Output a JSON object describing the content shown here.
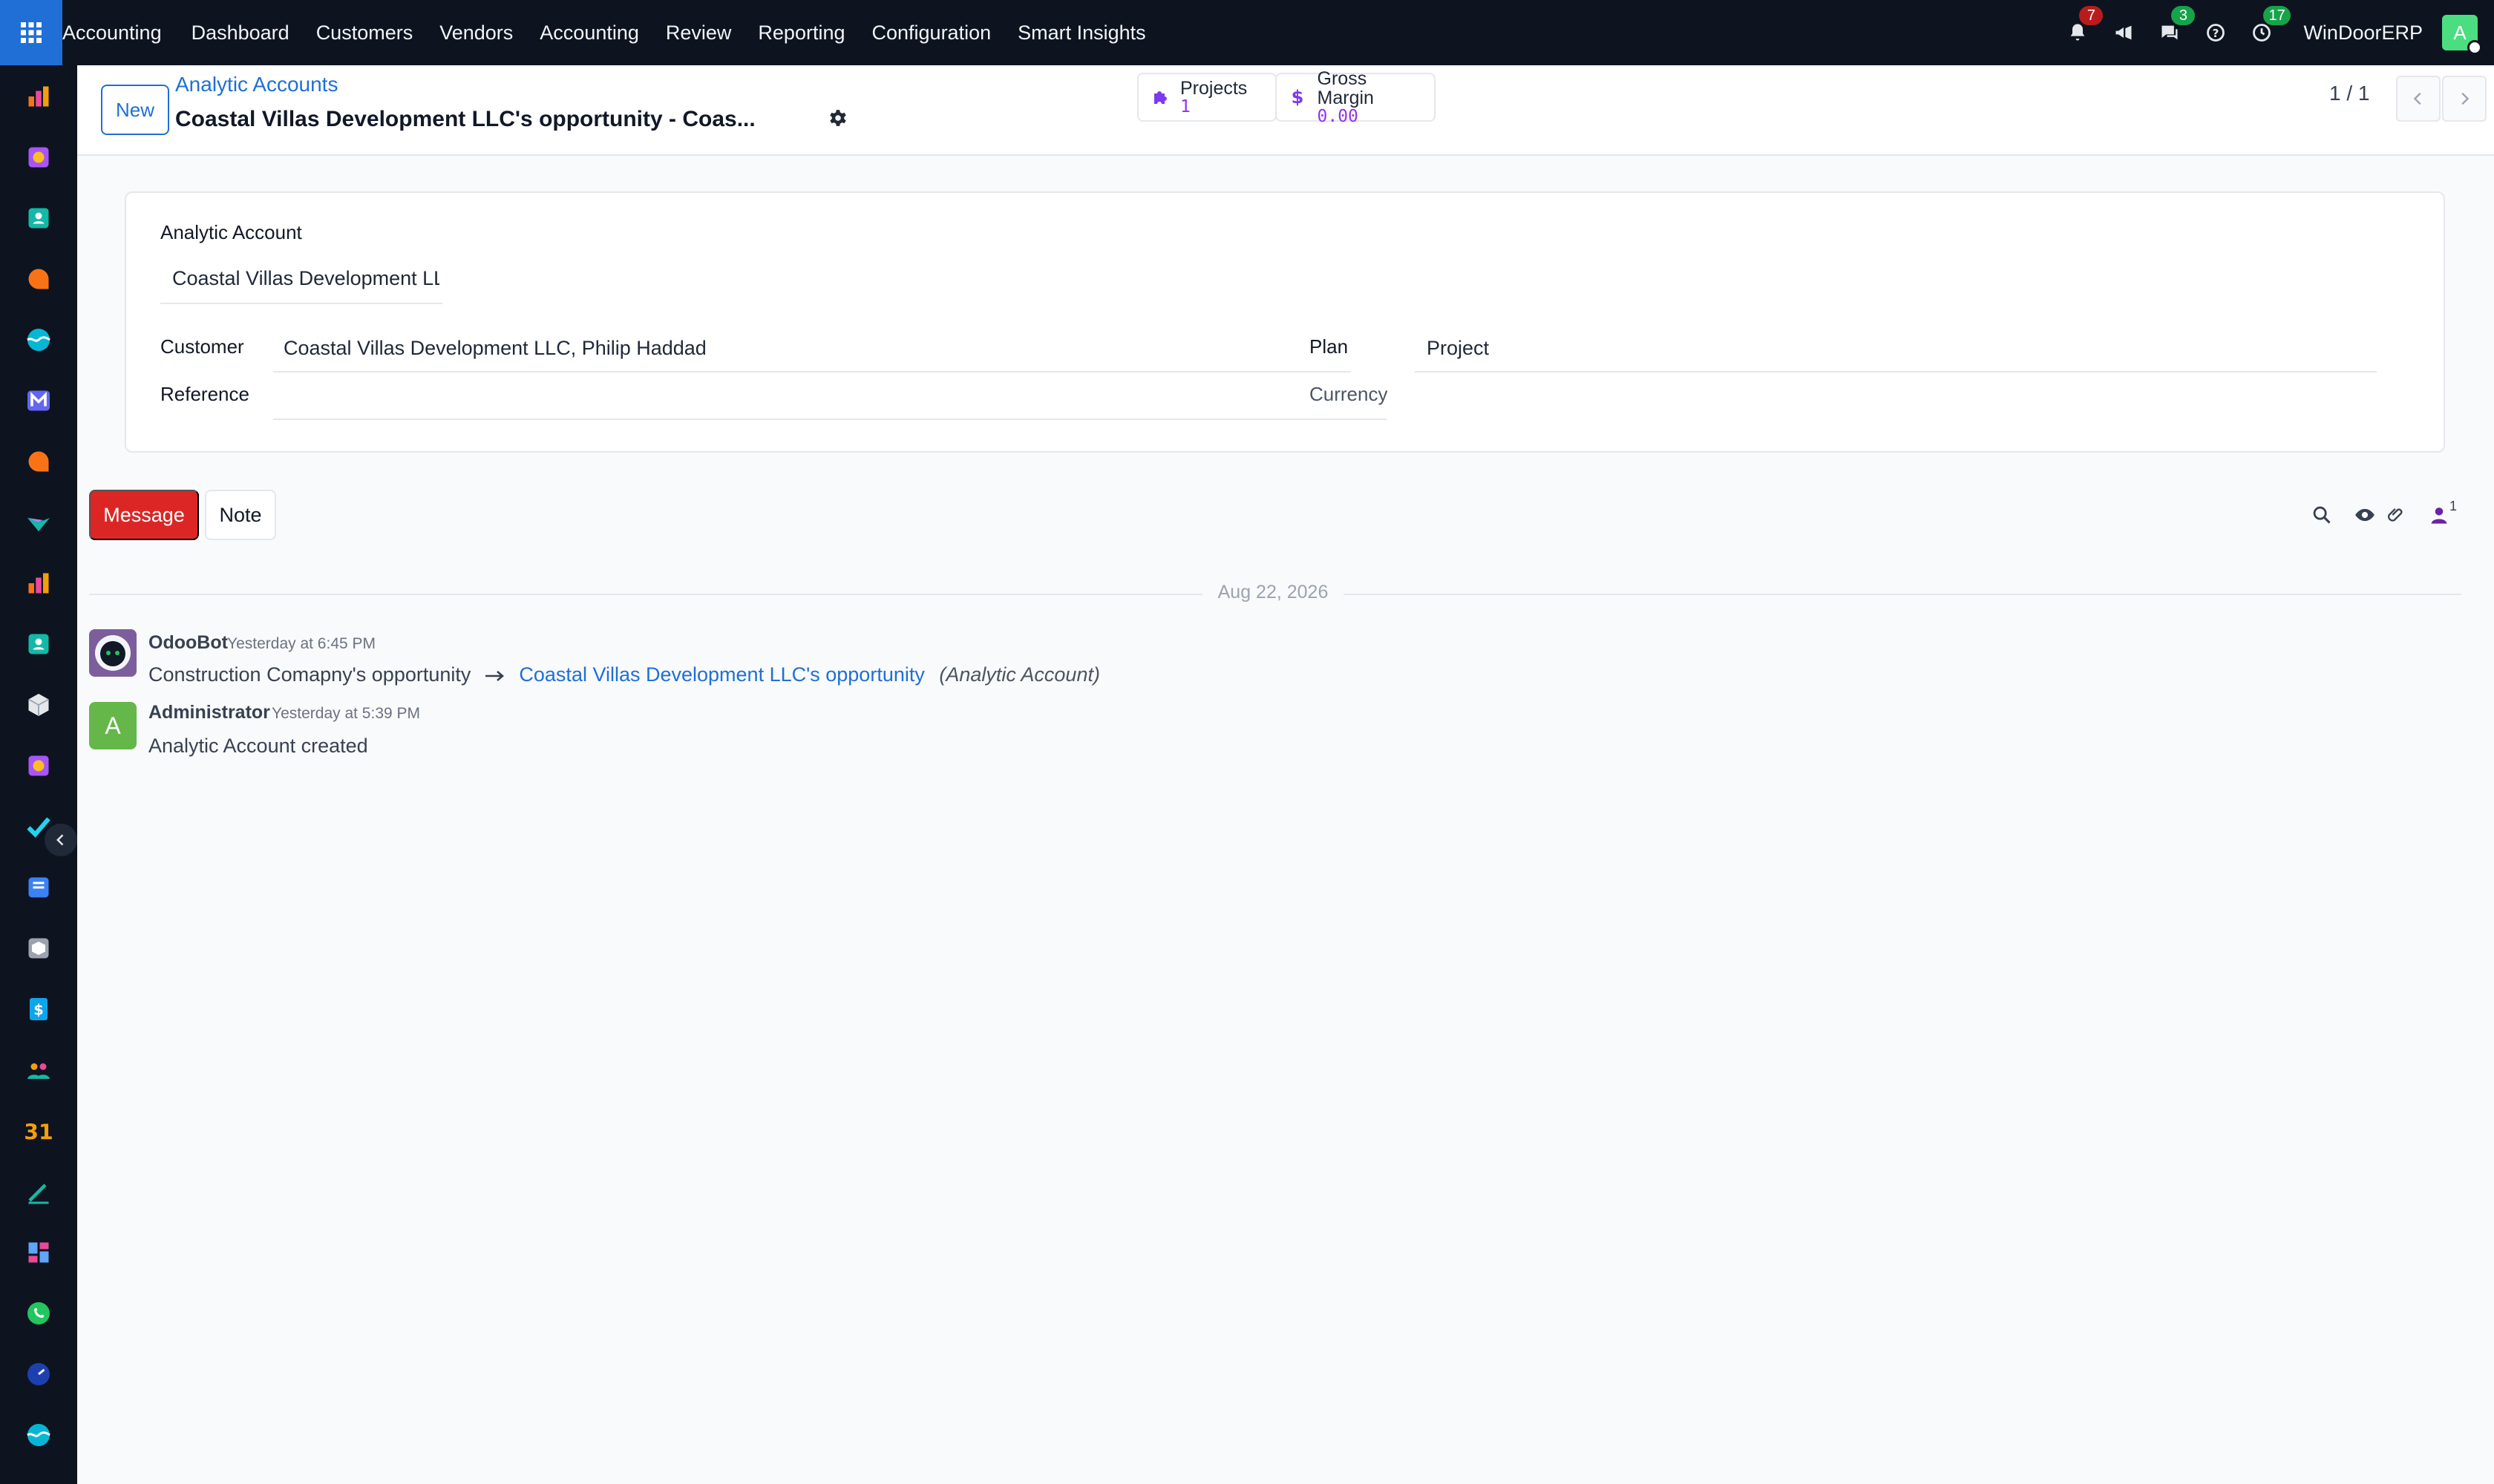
{
  "topbar": {
    "app_name": "Accounting",
    "menu": [
      "Dashboard",
      "Customers",
      "Vendors",
      "Accounting",
      "Review",
      "Reporting",
      "Configuration",
      "Smart Insights"
    ],
    "notifications_count": "7",
    "messages_count": "3",
    "activities_count": "17",
    "company": "WinDoorERP",
    "user_initial": "A"
  },
  "control_panel": {
    "new_label": "New",
    "breadcrumb_parent": "Analytic Accounts",
    "record_title": "Coastal Villas Development LLC's opportunity - Coas...",
    "smart_buttons": {
      "projects": {
        "label": "Projects",
        "value": "1"
      },
      "gross_margin": {
        "label": "Gross Margin",
        "value": "0.00"
      }
    },
    "pager": "1 / 1"
  },
  "form": {
    "analytic_account_label": "Analytic Account",
    "analytic_account_value": "Coastal Villas Development LLC",
    "customer_label": "Customer",
    "customer_value": "Coastal Villas Development LLC, Philip Haddad",
    "reference_label": "Reference",
    "reference_value": "",
    "plan_label": "Plan",
    "plan_value": "Project",
    "currency_label": "Currency",
    "currency_value": ""
  },
  "chatter": {
    "message_label": "Message",
    "note_label": "Note",
    "followers_count": "1",
    "date_separator": "Aug 22, 2026",
    "messages": [
      {
        "author": "OdooBot",
        "time": "Yesterday at 6:45 PM",
        "old_value": "Construction Comapny's opportunity",
        "new_value": "Coastal Villas Development LLC's opportunity",
        "field": "(Analytic Account)"
      },
      {
        "author": "Administrator",
        "author_initial": "A",
        "time": "Yesterday at 5:39 PM",
        "body": "Analytic Account created"
      }
    ]
  },
  "colors": {
    "nav_bg": "#0d1420",
    "accent": "#1f6fd6",
    "message_button": "#dc2626",
    "admin_avatar": "#65b74a"
  }
}
